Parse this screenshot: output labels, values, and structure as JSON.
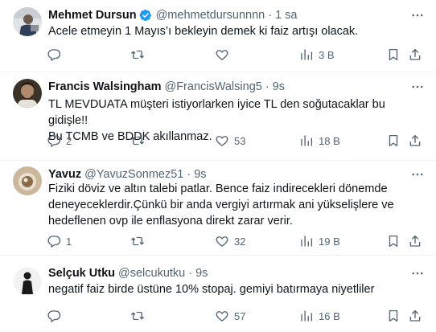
{
  "tweets": [
    {
      "name": "Mehmet Dursun",
      "verified": true,
      "handle": "@mehmetdursunnnn",
      "dot": "·",
      "time": "1 sa",
      "text": "Acele etmeyin 1 Mayıs’ı bekleyin demek ki faiz artışı olacak.",
      "replies": "",
      "retweets": "",
      "likes": "",
      "views": "3 B"
    },
    {
      "name": "Francis Walsingham",
      "verified": false,
      "handle": "@FrancisWalsing5",
      "dot": "·",
      "time": "9s",
      "text": "TL MEVDUATA müşteri istiyorlarken iyice TL den soğutacaklar bu gidişle!!\nBu TCMB ve BDDK akıllanmaz.",
      "replies": "2",
      "retweets": "",
      "likes": "53",
      "views": "18 B"
    },
    {
      "name": "Yavuz",
      "verified": false,
      "handle": "@YavuzSonmez51",
      "dot": "·",
      "time": "9s",
      "text": "Fiziki döviz ve altın talebi patlar. Bence faiz indirecekleri dönemde\ndeneyeceklerdir.Çünkü bir anda vergiyi artırmak ani yükselişlere ve\nhedeflenen ovp ile enflasyona direkt zarar verir.",
      "replies": "1",
      "retweets": "",
      "likes": "32",
      "views": "19 B"
    },
    {
      "name": "Selçuk Utku",
      "verified": false,
      "handle": "@selcukutku",
      "dot": "·",
      "time": "9s",
      "text": "negatif faiz birde üstüne  10% stopaj. gemiyi batırmaya niyetliler",
      "replies": "",
      "retweets": "",
      "likes": "57",
      "views": "16 B"
    }
  ],
  "colors": {
    "text_primary": "#0f1419",
    "text_secondary": "#536471",
    "verified_blue": "#1d9bf0",
    "divider": "#eff3f4"
  }
}
